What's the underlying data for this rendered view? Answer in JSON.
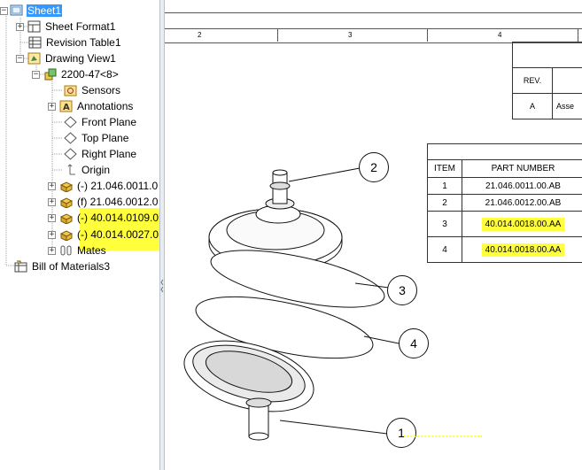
{
  "tree": {
    "items": [
      {
        "label": "Sheet1",
        "icon": "sheet-icon"
      },
      {
        "label": "Sheet Format1",
        "icon": "sheet-format-icon"
      },
      {
        "label": "Revision Table1",
        "icon": "revision-table-icon"
      },
      {
        "label": "Drawing View1",
        "icon": "drawing-view-icon"
      },
      {
        "label": "2200-47<8>",
        "icon": "assembly-icon"
      },
      {
        "label": "Sensors",
        "icon": "sensors-icon"
      },
      {
        "label": "Annotations",
        "icon": "annotations-icon"
      },
      {
        "label": "Front Plane",
        "icon": "plane-icon"
      },
      {
        "label": "Top Plane",
        "icon": "plane-icon"
      },
      {
        "label": "Right Plane",
        "icon": "plane-icon"
      },
      {
        "label": "Origin",
        "icon": "origin-icon"
      },
      {
        "label": "(-) 21.046.0011.0",
        "icon": "part-icon"
      },
      {
        "label": "(f) 21.046.0012.0",
        "icon": "part-icon"
      },
      {
        "label": "(-) 40.014.0109.0",
        "icon": "part-icon"
      },
      {
        "label": "(-) 40.014.0027.0",
        "icon": "part-icon"
      },
      {
        "label": "Mates",
        "icon": "mates-icon"
      },
      {
        "label": "Bill of Materials3",
        "icon": "bom-icon"
      }
    ]
  },
  "ruler": {
    "labels": [
      "2",
      "3",
      "4"
    ]
  },
  "revision_table": {
    "rev_header": "REV.",
    "rev_value": "A",
    "desc_partial": "Asse"
  },
  "bom": {
    "headers": [
      "ITEM",
      "PART NUMBER"
    ],
    "rows": [
      {
        "item": "1",
        "part": "21.046.0011.00.AB"
      },
      {
        "item": "2",
        "part": "21.046.0012.00.AB"
      },
      {
        "item": "3",
        "part": "40.014.0018.00.AA"
      },
      {
        "item": "4",
        "part": "40.014.0018.00.AA"
      }
    ]
  },
  "balloons": [
    "1",
    "2",
    "3",
    "4"
  ],
  "colors": {
    "selection": "#3399ff",
    "highlight": "#ffff3c"
  }
}
